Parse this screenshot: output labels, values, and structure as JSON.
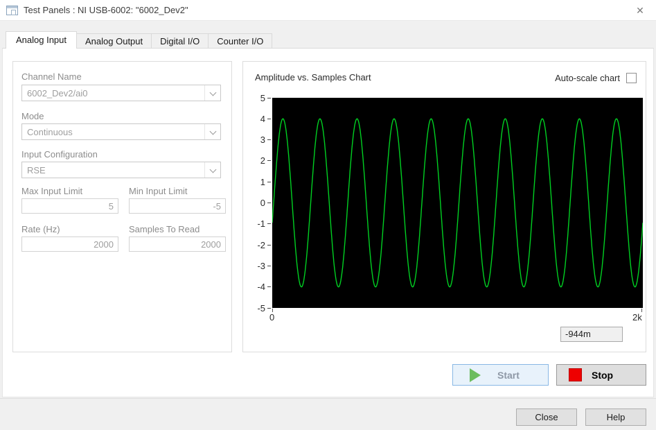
{
  "window": {
    "title": "Test Panels : NI USB-6002: \"6002_Dev2\"",
    "close_glyph": "✕"
  },
  "tabs": [
    {
      "label": "Analog Input",
      "active": true
    },
    {
      "label": "Analog Output",
      "active": false
    },
    {
      "label": "Digital I/O",
      "active": false
    },
    {
      "label": "Counter I/O",
      "active": false
    }
  ],
  "form": {
    "channel_name": {
      "label": "Channel Name",
      "value": "6002_Dev2/ai0"
    },
    "mode": {
      "label": "Mode",
      "value": "Continuous"
    },
    "input_config": {
      "label": "Input Configuration",
      "value": "RSE"
    },
    "max_input": {
      "label": "Max Input Limit",
      "value": "5"
    },
    "min_input": {
      "label": "Min Input Limit",
      "value": "-5"
    },
    "rate": {
      "label": "Rate (Hz)",
      "value": "2000"
    },
    "samples": {
      "label": "Samples To Read",
      "value": "2000"
    }
  },
  "chart": {
    "title": "Amplitude vs. Samples Chart",
    "autoscale_label": "Auto-scale chart",
    "autoscale_checked": false,
    "current_reading": "-944m"
  },
  "chart_data": {
    "type": "line",
    "title": "Amplitude vs. Samples Chart",
    "xlabel": "",
    "ylabel": "",
    "x_range": [
      0,
      2000
    ],
    "y_range": [
      -5,
      5
    ],
    "x_tick_labels": [
      "0",
      "2k"
    ],
    "y_tick_values": [
      5,
      4,
      3,
      2,
      1,
      0,
      -1,
      -2,
      -3,
      -4,
      -5
    ],
    "grid": false,
    "legend": "none",
    "plot_background": "#000000",
    "series": [
      {
        "name": "6002_Dev2/ai0",
        "color": "#00d022",
        "waveform": "sine",
        "amplitude": 4.0,
        "offset": 0.0,
        "cycles": 10,
        "n_samples": 2000,
        "phase_rad": -0.2382,
        "first_sample": -0.944,
        "last_sample": -0.944
      }
    ],
    "current_reading": "-944m"
  },
  "controls": {
    "start_label": "Start",
    "stop_label": "Stop"
  },
  "footer": {
    "close_label": "Close",
    "help_label": "Help"
  }
}
